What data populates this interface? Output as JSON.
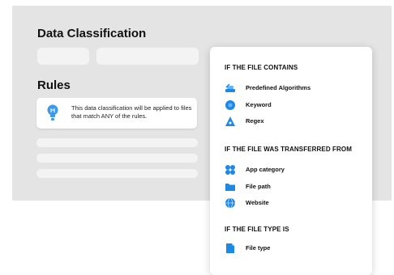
{
  "page": {
    "title": "Data Classification",
    "rules_heading": "Rules",
    "info_text": "This data classification will be applied to files that match ANY of the rules."
  },
  "dropdown": {
    "sections": [
      {
        "heading": "IF THE FILE CONTAINS",
        "items": [
          {
            "label": "Predefined Algorithms",
            "icon": "algorithm-icon"
          },
          {
            "label": "Keyword",
            "icon": "keyword-icon"
          },
          {
            "label": "Regex",
            "icon": "regex-icon"
          }
        ]
      },
      {
        "heading": "IF THE FILE WAS TRANSFERRED FROM",
        "items": [
          {
            "label": "App category",
            "icon": "app-category-icon"
          },
          {
            "label": "File path",
            "icon": "folder-icon"
          },
          {
            "label": "Website",
            "icon": "globe-icon"
          }
        ]
      },
      {
        "heading": "IF THE FILE TYPE IS",
        "items": [
          {
            "label": "File type",
            "icon": "file-icon"
          }
        ]
      }
    ]
  },
  "colors": {
    "accent": "#1e88e5",
    "panel": "#e4e4e4",
    "placeholder": "#f3f3f3"
  }
}
